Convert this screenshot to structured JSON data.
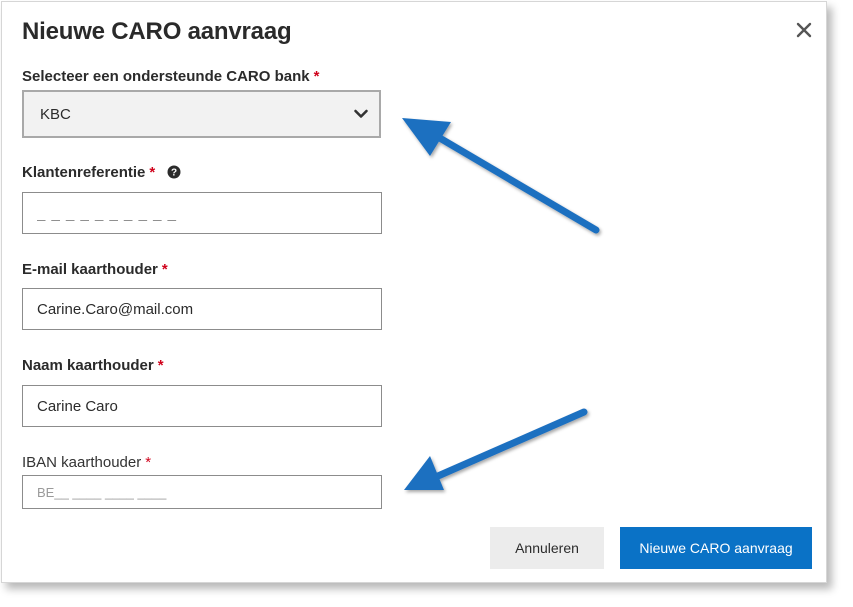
{
  "dialog": {
    "title": "Nieuwe CARO aanvraag",
    "close_icon": "close-icon"
  },
  "form": {
    "bank": {
      "label": "Selecteer een ondersteunde CARO bank",
      "required_mark": "*",
      "value": "KBC"
    },
    "client_reference": {
      "label": "Klantenreferentie",
      "required_mark": "*",
      "placeholder": "_ _ _ _ _ _ _ _ _ _",
      "help_icon": "question-circle-icon"
    },
    "email": {
      "label": "E-mail kaarthouder",
      "required_mark": "*",
      "value": "Carine.Caro@mail.com"
    },
    "name": {
      "label": "Naam kaarthouder",
      "required_mark": "*",
      "value": "Carine Caro"
    },
    "iban": {
      "label": "IBAN kaarthouder",
      "required_mark": "*",
      "placeholder": "BE__ ____ ____ ____"
    }
  },
  "footer": {
    "cancel_label": "Annuleren",
    "submit_label": "Nieuwe CARO aanvraag"
  },
  "colors": {
    "primary": "#0a72c6",
    "required": "#d0021b",
    "annotation_arrow": "#1f6fc0"
  }
}
